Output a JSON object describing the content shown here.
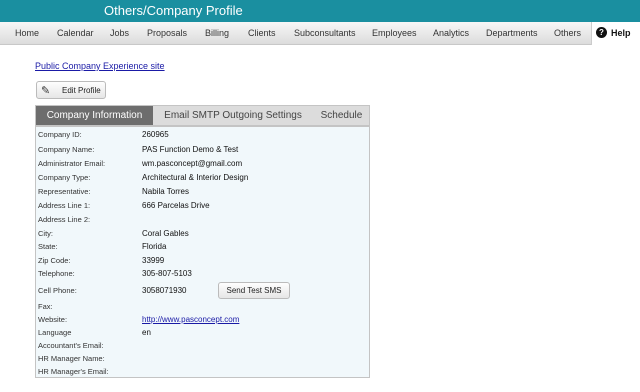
{
  "header": {
    "title": "Others/Company Profile"
  },
  "nav": {
    "items": [
      "Home",
      "Calendar",
      "Jobs",
      "Proposals",
      "Billing",
      "Clients",
      "Subconsultants",
      "Employees",
      "Analytics",
      "Departments",
      "Others"
    ],
    "help_label": "Help"
  },
  "public_link": "Public Company Experience site",
  "edit_button": "Edit Profile",
  "tabs": [
    "Company Information",
    "Email SMTP Outgoing Settings",
    "Schedule"
  ],
  "fields": [
    {
      "label": "Company ID:",
      "value": "260965"
    },
    {
      "label": "Company Name:",
      "value": "PAS Function Demo & Test"
    },
    {
      "label": "Administrator Email:",
      "value": "wm.pasconcept@gmail.com"
    },
    {
      "label": "Company Type:",
      "value": "Architectural & Interior Design"
    },
    {
      "label": "Representative:",
      "value": "Nabila Torres"
    },
    {
      "label": "Address Line 1:",
      "value": "666 Parcelas Drive"
    },
    {
      "label": "Address Line 2:",
      "value": ""
    },
    {
      "label": "City:",
      "value": "Coral Gables"
    },
    {
      "label": "State:",
      "value": "Florida"
    },
    {
      "label": "Zip Code:",
      "value": "33999"
    },
    {
      "label": "Telephone:",
      "value": "305-807-5103"
    },
    {
      "label": "Cell Phone:",
      "value": "3058071930"
    },
    {
      "label": "Fax:",
      "value": ""
    },
    {
      "label": "Website:",
      "value": "http://www.pasconcept.com"
    },
    {
      "label": "Language",
      "value": "en"
    },
    {
      "label": "Accountant's Email:",
      "value": ""
    },
    {
      "label": "HR Manager Name:",
      "value": ""
    },
    {
      "label": "HR Manager's Email:",
      "value": ""
    }
  ],
  "sms_button": "Send Test SMS",
  "colors": {
    "header_bg": "#1a8fa0",
    "active_tab": "#6d6d6d",
    "panel_bg": "#f1f8fb",
    "link": "#1a1aa6"
  }
}
